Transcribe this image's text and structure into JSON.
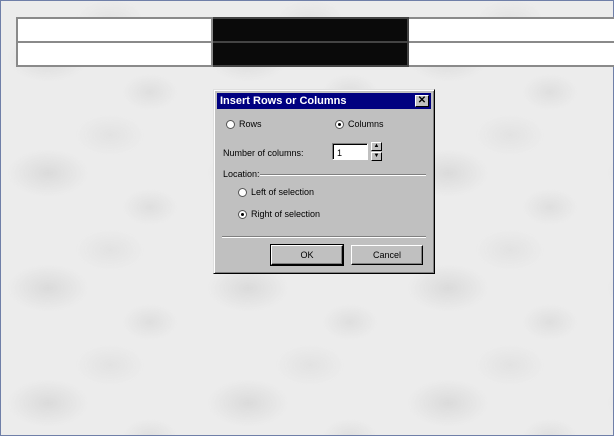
{
  "dialog": {
    "title": "Insert Rows or Columns",
    "close_glyph": "✕",
    "insert_options": [
      {
        "label": "Rows",
        "selected": false
      },
      {
        "label": "Columns",
        "selected": true
      }
    ],
    "count_label": "Number of columns:",
    "count_value": "1",
    "location_label": "Location:",
    "location_options": [
      {
        "label": "Left of selection",
        "selected": false
      },
      {
        "label": "Right of selection",
        "selected": true
      }
    ],
    "ok_label": "OK",
    "cancel_label": "Cancel"
  },
  "table": {
    "rows": 2,
    "columns": 3,
    "selected_column": 2
  },
  "colors": {
    "titlebar": "#000080",
    "dialog_face": "#c0c0c0",
    "selected_cells": "#0a0a0a"
  }
}
